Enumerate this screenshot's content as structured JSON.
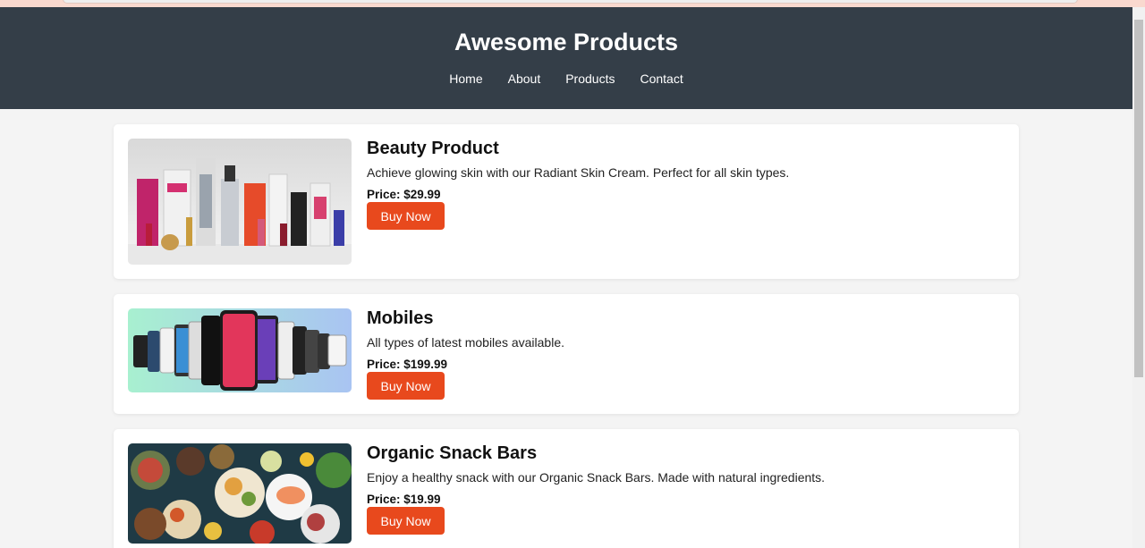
{
  "site": {
    "title": "Awesome Products",
    "nav": [
      "Home",
      "About",
      "Products",
      "Contact"
    ]
  },
  "products": [
    {
      "name": "Beauty Product",
      "description": "Achieve glowing skin with our Radiant Skin Cream. Perfect for all skin types.",
      "price": "Price: $29.99",
      "button": "Buy Now",
      "image_icon": "cosmetics-image"
    },
    {
      "name": "Mobiles",
      "description": "All types of latest mobiles available.",
      "price": "Price: $199.99",
      "button": "Buy Now",
      "image_icon": "smartphones-image"
    },
    {
      "name": "Organic Snack Bars",
      "description": "Enjoy a healthy snack with our Organic Snack Bars. Made with natural ingredients.",
      "price": "Price: $19.99",
      "button": "Buy Now",
      "image_icon": "food-bowls-image"
    }
  ],
  "colors": {
    "header_bg": "#343e48",
    "accent": "#e8491d",
    "page_bg": "#f4f4f4"
  }
}
